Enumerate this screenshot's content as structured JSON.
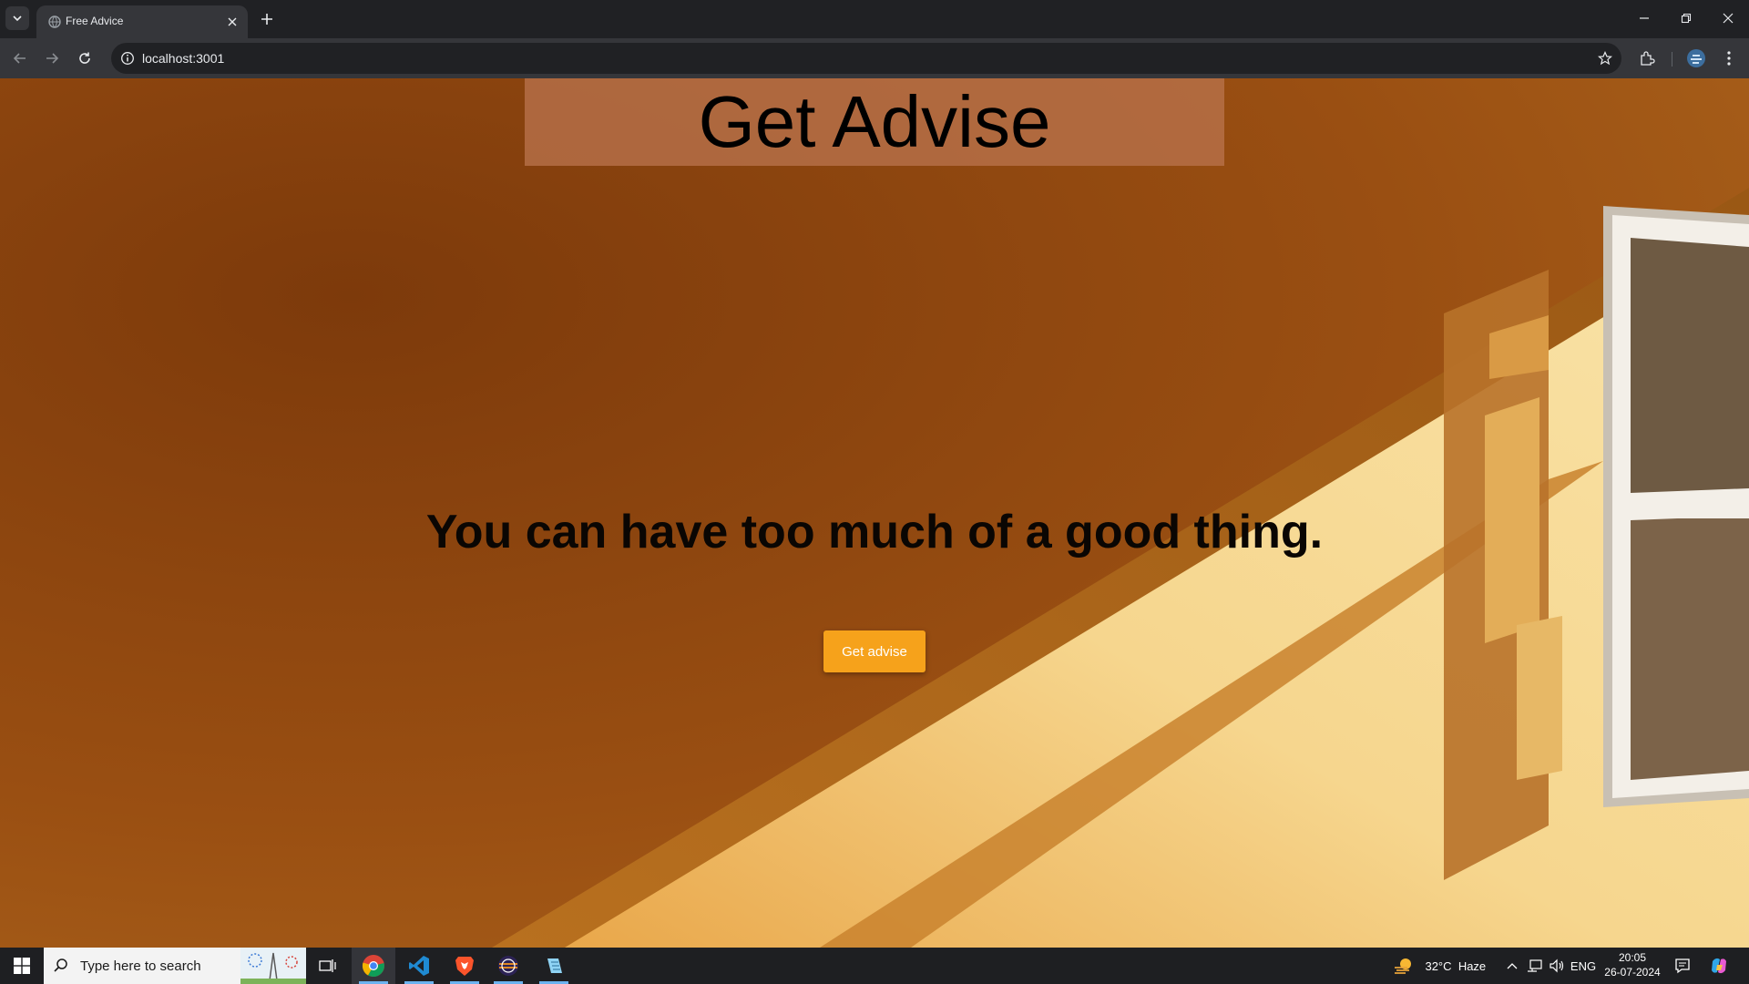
{
  "browser": {
    "tab_title": "Free Advice",
    "url": "localhost:3001"
  },
  "page": {
    "header_title": "Get Advise",
    "advice": "You can have too much of a good thing.",
    "button_label": "Get advise"
  },
  "taskbar": {
    "search_placeholder": "Type here to search",
    "weather_temp": "32°C",
    "weather_desc": "Haze",
    "language": "ENG",
    "time": "20:05",
    "date": "26-07-2024",
    "apps": [
      "chrome-icon",
      "vscode-icon",
      "brave-icon",
      "eclipse-icon",
      "notepad-icon"
    ]
  },
  "colors": {
    "button": "#f6a21b",
    "header_box": "#b8724c",
    "wall_dark": "#8a430e",
    "wall_light": "#f4d48a"
  }
}
